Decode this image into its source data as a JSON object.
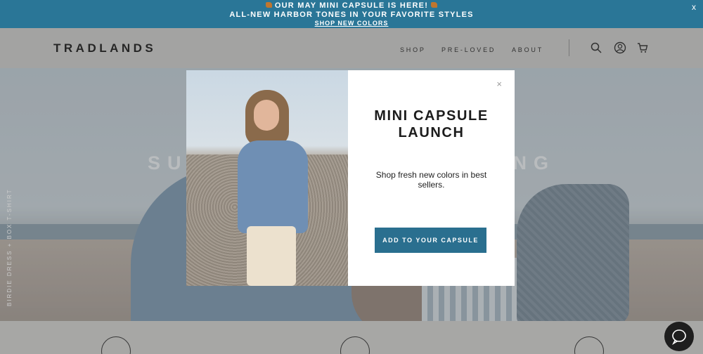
{
  "announcement": {
    "line1": "OUR MAY MINI CAPSULE IS HERE!",
    "line2": "ALL-NEW HARBOR TONES IN YOUR FAVORITE STYLES",
    "link": "SHOP NEW COLORS",
    "close": "x"
  },
  "header": {
    "logo": "TRADLANDS",
    "nav": [
      "SHOP",
      "PRE-LOVED",
      "ABOUT"
    ]
  },
  "hero": {
    "title": "SUMMER READY CLOTHING",
    "side_label": "BIRDIE DRESS + BOX T-SHIRT"
  },
  "modal": {
    "close": "×",
    "title": "MINI CAPSULE LAUNCH",
    "subtitle": "Shop fresh new colors in best sellers.",
    "cta": "ADD TO YOUR CAPSULE"
  },
  "colors": {
    "accent": "#2a7697",
    "cta": "#2a6f8f",
    "header_bg": "#c8c8c6"
  },
  "icons": [
    "search-icon",
    "account-icon",
    "cart-icon",
    "shipping-icon",
    "heart-icon",
    "search-person-icon",
    "chat-icon"
  ]
}
